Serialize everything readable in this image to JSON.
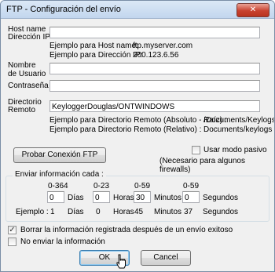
{
  "window": {
    "title": "FTP - Configuración del envío",
    "close_glyph": "✕"
  },
  "host": {
    "label_line1": "Host name",
    "label_line2": "Dirección IP",
    "value": "",
    "example_host_label": "Ejemplo para Host name:",
    "example_host_value": "ftp.myserver.com",
    "example_ip_label": "Ejemplo para Dirección IP:",
    "example_ip_value": "200.123.6.56"
  },
  "user": {
    "label_line1": "Nombre",
    "label_line2": "de Usuario",
    "value": ""
  },
  "password": {
    "label": "Contraseña",
    "value": ""
  },
  "remote_dir": {
    "label_line1": "Directorio",
    "label_line2": "Remoto",
    "value": "KeyloggerDouglas/ONTWINDOWS",
    "example_abs_label": "Ejemplo para Directorio Remoto (Absoluto - Raíz) :",
    "example_abs_value": "/Documents/Keylogs",
    "example_rel_label": "Ejemplo para Directorio Remoto (Relativo) :",
    "example_rel_value": "Documents/keylogs"
  },
  "test_button": "Probar Conexión FTP",
  "passive": {
    "label": "Usar modo pasivo",
    "note": "(Necesario para algunos firewalls)",
    "checked": false
  },
  "interval": {
    "group_title": "Enviar información cada :",
    "ranges": [
      "0-364",
      "0-23",
      "0-59",
      "0-59"
    ],
    "values": [
      "0",
      "0",
      "30",
      "0"
    ],
    "units": [
      "Días",
      "Horas",
      "Minutos",
      "Segundos"
    ],
    "example_label": "Ejemplo :",
    "example_values": [
      "1",
      "0",
      "45",
      "37"
    ]
  },
  "options": {
    "delete_label": "Borrar la información registrada después de un envío exitoso",
    "delete_checked": true,
    "nosend_label": "No enviar la información",
    "nosend_checked": false,
    "check_glyph": "✓"
  },
  "buttons": {
    "ok": "OK",
    "cancel": "Cancel"
  }
}
